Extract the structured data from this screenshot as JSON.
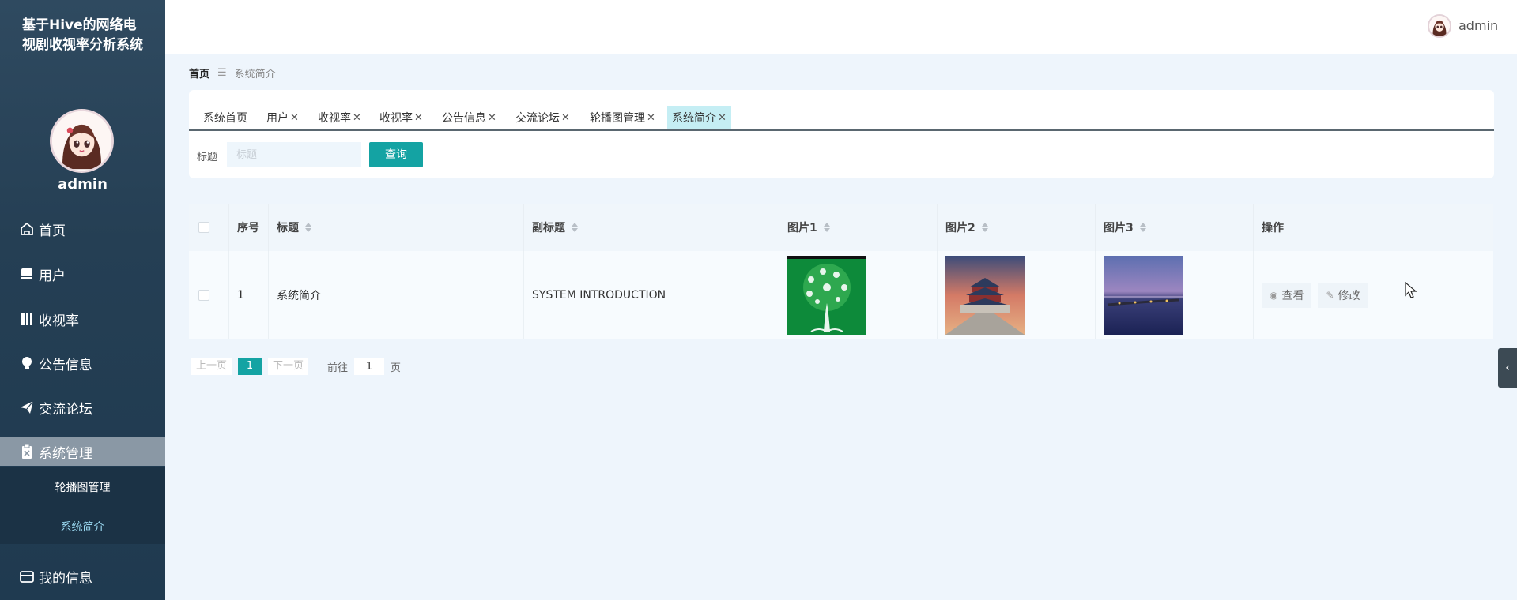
{
  "sidebar": {
    "title": "基于Hive的网络电视剧收视率分析系统",
    "username": "admin",
    "menu": [
      {
        "label": "首页",
        "icon": "home-icon"
      },
      {
        "label": "用户",
        "icon": "user-icon"
      },
      {
        "label": "收视率",
        "icon": "book-icon"
      },
      {
        "label": "公告信息",
        "icon": "bulb-icon"
      },
      {
        "label": "交流论坛",
        "icon": "send-icon"
      },
      {
        "label": "系统管理",
        "icon": "clipboard-icon"
      },
      {
        "label": "我的信息",
        "icon": "card-icon"
      }
    ],
    "submenu": [
      {
        "label": "轮播图管理"
      },
      {
        "label": "系统简介"
      }
    ]
  },
  "header": {
    "username": "admin"
  },
  "breadcrumb": {
    "home": "首页",
    "separator": "☰",
    "current": "系统简介"
  },
  "tabs": [
    {
      "label": "系统首页",
      "closable": ""
    },
    {
      "label": "用户",
      "closable": "✕"
    },
    {
      "label": "收视率",
      "closable": "✕"
    },
    {
      "label": "收视率",
      "closable": "✕"
    },
    {
      "label": "公告信息",
      "closable": "✕"
    },
    {
      "label": "交流论坛",
      "closable": "✕"
    },
    {
      "label": "轮播图管理",
      "closable": "✕"
    },
    {
      "label": "系统简介",
      "closable": "✕"
    }
  ],
  "search": {
    "label": "标题",
    "placeholder": "标题",
    "value": "",
    "button": "查询"
  },
  "table": {
    "columns": [
      "序号",
      "标题",
      "副标题",
      "图片1",
      "图片2",
      "图片3",
      "操作"
    ],
    "rows": [
      {
        "index": "1",
        "title": "系统简介",
        "subtitle": "SYSTEM INTRODUCTION",
        "actions": {
          "view": "查看",
          "edit": "修改"
        }
      }
    ]
  },
  "pagination": {
    "prev": "上一页",
    "current": "1",
    "next": "下一页",
    "goto": "前往",
    "goto_value": "1",
    "unit": "页"
  },
  "colors": {
    "accent": "#14a3a3",
    "sidebar": "#253f54",
    "active_tab": "#c5eef4"
  }
}
